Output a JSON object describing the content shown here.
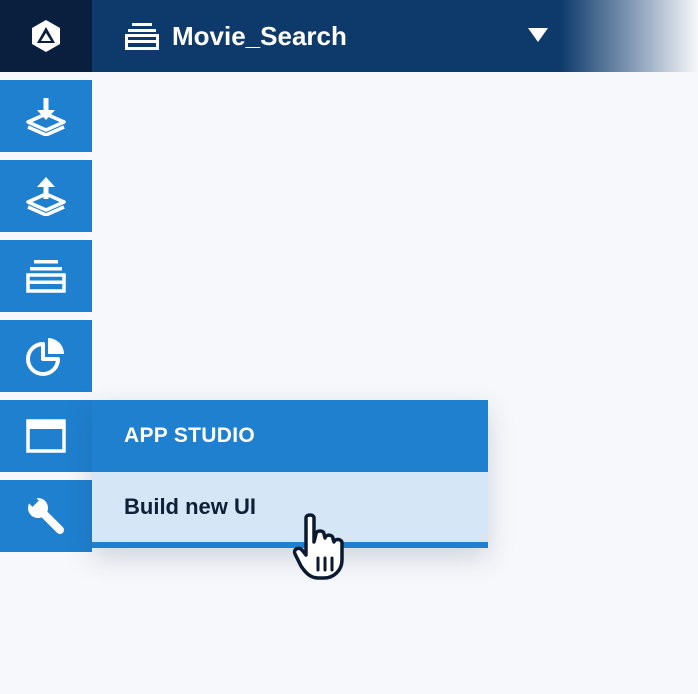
{
  "topbar": {
    "logo_icon": "triangle-logo-icon",
    "collection_icon": "collection-icon",
    "collection_name": "Movie_Search",
    "dropdown_icon": "caret-down-icon"
  },
  "sidebar": {
    "items": [
      {
        "id": "import",
        "icon": "import-icon"
      },
      {
        "id": "export",
        "icon": "export-icon"
      },
      {
        "id": "collections",
        "icon": "collection-icon"
      },
      {
        "id": "analytics",
        "icon": "pie-chart-icon"
      },
      {
        "id": "app-studio",
        "icon": "window-icon"
      },
      {
        "id": "tools",
        "icon": "wrench-icon"
      }
    ]
  },
  "app_studio_menu": {
    "header": "APP STUDIO",
    "items": [
      {
        "label": "Build new UI"
      }
    ]
  },
  "colors": {
    "topbar_bg": "#0d3a6b",
    "logo_bg": "#0a1f3e",
    "accent": "#1f80cf",
    "menu_item_bg": "#d5e6f6"
  }
}
